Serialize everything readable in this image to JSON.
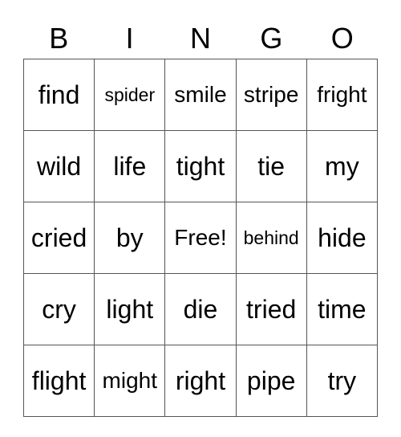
{
  "header": [
    "B",
    "I",
    "N",
    "G",
    "O"
  ],
  "rows": [
    [
      "find",
      "spider",
      "smile",
      "stripe",
      "fright"
    ],
    [
      "wild",
      "life",
      "tight",
      "tie",
      "my"
    ],
    [
      "cried",
      "by",
      "Free!",
      "behind",
      "hide"
    ],
    [
      "cry",
      "light",
      "die",
      "tried",
      "time"
    ],
    [
      "flight",
      "might",
      "right",
      "pipe",
      "try"
    ]
  ]
}
